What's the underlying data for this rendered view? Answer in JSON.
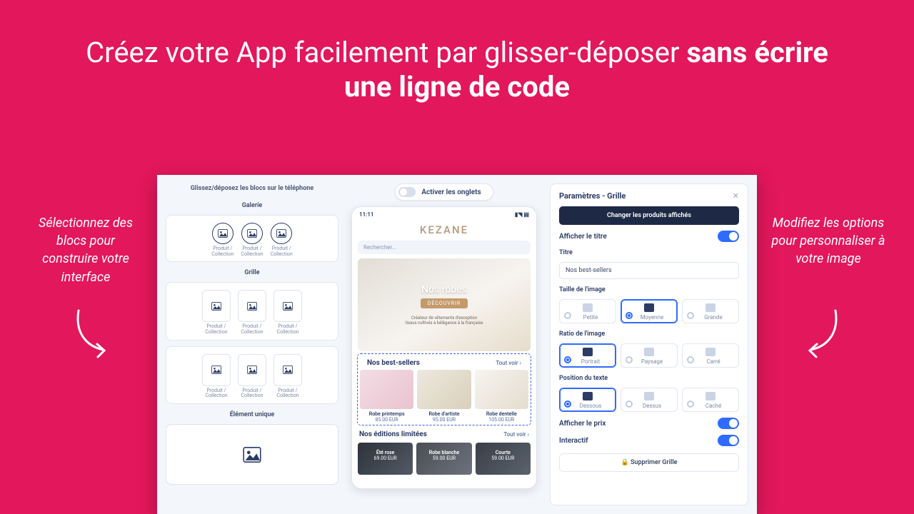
{
  "headline": {
    "regular": "Créez votre App facilement par glisser-déposer ",
    "bold": "sans écrire une ligne de code"
  },
  "callouts": {
    "left": "Sélectionnez des blocs pour construire votre interface",
    "right": "Modifiez les options pour personnaliser à votre image"
  },
  "leftPanel": {
    "title": "Glissez/déposez les blocs sur le téléphone",
    "groups": {
      "gallery": "Galerie",
      "grid": "Grille",
      "unique": "Élément unique"
    },
    "itemLabel1": "Produit /",
    "itemLabel2": "Collection"
  },
  "midPanel": {
    "tabsToggle": "Activer les onglets",
    "time": "11:11",
    "brand": "KEZANE",
    "searchPlaceholder": "Rechercher...",
    "hero": {
      "title": "Nos robes",
      "cta": "DÉCOUVRIR",
      "tag1": "Créateur de vêtements d'exception",
      "tag2": "tissus cultivés à bélégance à la française"
    },
    "section1": {
      "title": "Nos best-sellers",
      "link": "Tout voir  ›"
    },
    "section2": {
      "title": "Nos éditions limitées",
      "link": "Tout voir  ›"
    },
    "products": [
      {
        "name": "Robe printemps",
        "price": "85.00 EUR"
      },
      {
        "name": "Robe d'artiste",
        "price": "95.00 EUR"
      },
      {
        "name": "Robe dentelle",
        "price": "105.00 EUR"
      }
    ],
    "limited": [
      {
        "name": "Été rose",
        "price": "69.00 EUR"
      },
      {
        "name": "Robe blanche",
        "price": "59.00 EUR"
      },
      {
        "name": "Courte",
        "price": "59.00 EUR"
      }
    ]
  },
  "rightPanel": {
    "title": "Paramètres - Grille",
    "changeBtn": "Changer les produits affichés",
    "showTitle": "Afficher le titre",
    "titleLabel": "Titre",
    "titleValue": "Nos best-sellers",
    "imgSize": {
      "label": "Taille de l'image",
      "opts": [
        "Petite",
        "Moyenne",
        "Grande"
      ],
      "selected": 1
    },
    "ratio": {
      "label": "Ratio de l'image",
      "opts": [
        "Portrait",
        "Paysage",
        "Carré"
      ],
      "selected": 0
    },
    "textPos": {
      "label": "Position du texte",
      "opts": [
        "Dessous",
        "Dessus",
        "Caché"
      ],
      "selected": 0
    },
    "showPrice": "Afficher le prix",
    "interactive": "Interactif",
    "delete": "Supprimer Grille",
    "lock": "🔒"
  }
}
